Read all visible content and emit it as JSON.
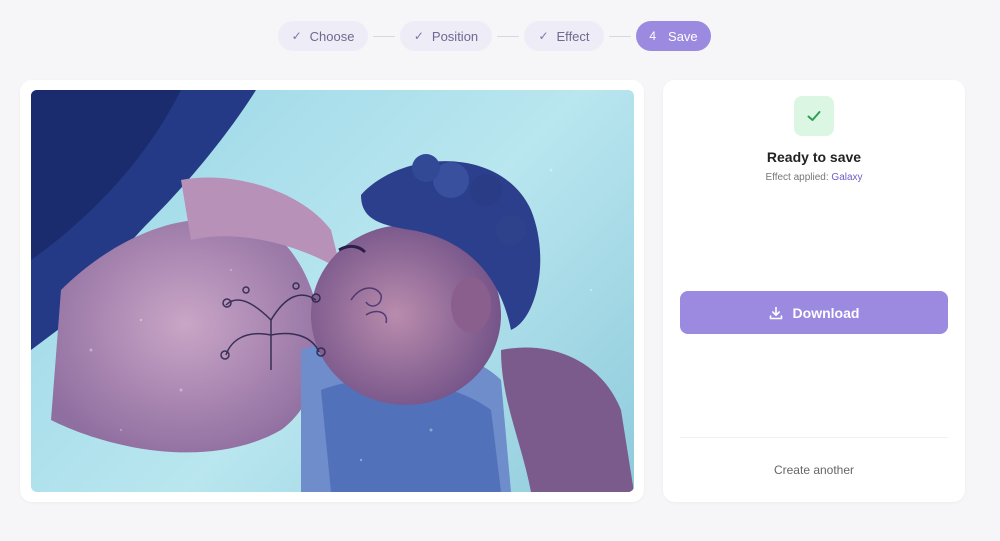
{
  "stepper": {
    "steps": [
      {
        "label": "Choose",
        "mark": "✓",
        "state": "done"
      },
      {
        "label": "Position",
        "mark": "✓",
        "state": "done"
      },
      {
        "label": "Effect",
        "mark": "✓",
        "state": "done"
      },
      {
        "label": "Save",
        "mark": "4",
        "state": "active"
      }
    ]
  },
  "preview": {
    "effect_style": "galaxy-stylized photo of mother breastfeeding infant"
  },
  "panel": {
    "status_icon": "check-icon",
    "title": "Ready to save",
    "effect_prefix": "Effect applied:",
    "effect_name": "Galaxy",
    "download_label": "Download",
    "download_icon": "download-icon",
    "create_another_label": "Create another"
  },
  "colors": {
    "accent": "#9b8ae0",
    "success_bg": "#dcf6e4",
    "success_check": "#2f9e57",
    "effect_link": "#6c5fc7"
  }
}
